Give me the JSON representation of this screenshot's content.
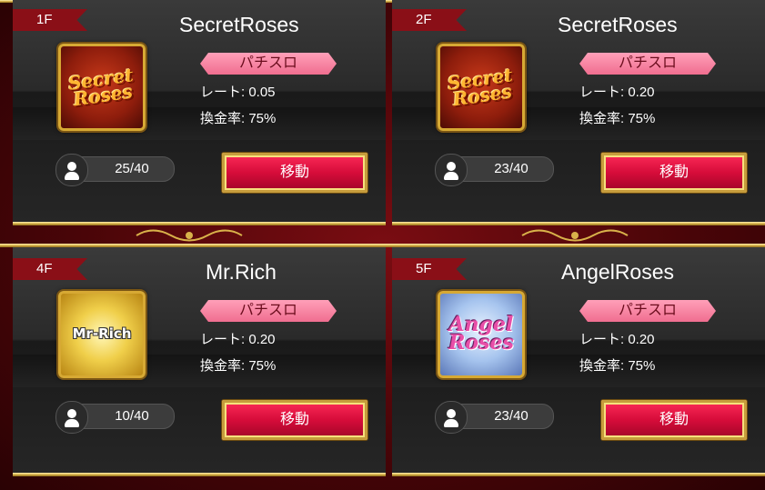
{
  "rooms": [
    {
      "floor": "1F",
      "title": "SecretRoses",
      "type": "パチスロ",
      "rate": "レート: 0.05",
      "exchange": "換金率: 75%",
      "occupancy": "25/40",
      "button": "移動",
      "thumb_icon": "secret-roses-logo",
      "thumb_text": "Secret Roses"
    },
    {
      "floor": "2F",
      "title": "SecretRoses",
      "type": "パチスロ",
      "rate": "レート: 0.20",
      "exchange": "換金率: 75%",
      "occupancy": "23/40",
      "button": "移動",
      "thumb_icon": "secret-roses-logo",
      "thumb_text": "Secret Roses"
    },
    {
      "floor": "4F",
      "title": "Mr.Rich",
      "type": "パチスロ",
      "rate": "レート: 0.20",
      "exchange": "換金率: 75%",
      "occupancy": "10/40",
      "button": "移動",
      "thumb_icon": "mr-rich-logo",
      "thumb_text": "Mr-Rich"
    },
    {
      "floor": "5F",
      "title": "AngelRoses",
      "type": "パチスロ",
      "rate": "レート: 0.20",
      "exchange": "換金率: 75%",
      "occupancy": "23/40",
      "button": "移動",
      "thumb_icon": "angel-roses-logo",
      "thumb_text": "Angel Roses"
    }
  ],
  "colors": {
    "background": "#4a0508",
    "floor_tag": "#8a0f17",
    "type_badge": "#f06e90",
    "move_button": "#d60c3a",
    "gold": "#d9b24a"
  }
}
